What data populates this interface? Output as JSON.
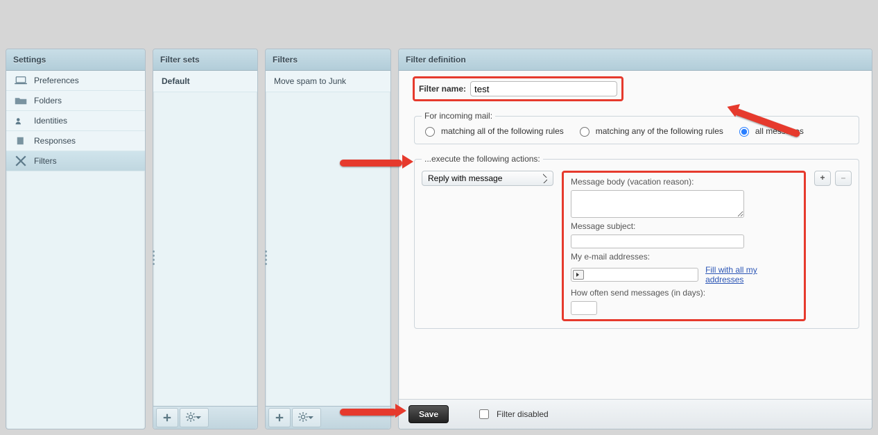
{
  "settings": {
    "title": "Settings",
    "items": [
      {
        "label": "Preferences",
        "icon": "laptop-icon"
      },
      {
        "label": "Folders",
        "icon": "folder-icon"
      },
      {
        "label": "Identities",
        "icon": "person-icon"
      },
      {
        "label": "Responses",
        "icon": "file-icon"
      },
      {
        "label": "Filters",
        "icon": "filter-icon",
        "selected": true
      }
    ]
  },
  "filter_sets": {
    "title": "Filter sets",
    "items": [
      {
        "label": "Default",
        "selected": true,
        "bold": true
      }
    ]
  },
  "filters": {
    "title": "Filters",
    "items": [
      {
        "label": "Move spam to Junk",
        "selected": false
      }
    ]
  },
  "definition": {
    "title": "Filter definition",
    "name_label": "Filter name:",
    "name_value": "test",
    "scope": {
      "legend": "For incoming mail:",
      "opt_all": "matching all of the following rules",
      "opt_any": "matching any of the following rules",
      "opt_every": "all messages",
      "selected": "every"
    },
    "actions": {
      "legend": "...execute the following actions:",
      "select_value": "Reply with message",
      "body_label": "Message body (vacation reason):",
      "body_value": "",
      "subject_label": "Message subject:",
      "subject_value": "",
      "addresses_label": "My e-mail addresses:",
      "fill_link": "Fill with all my addresses",
      "days_label": "How often send messages (in days):",
      "days_value": "",
      "plus": "+",
      "minus": "–"
    },
    "save_label": "Save",
    "disabled_label": "Filter disabled"
  },
  "footer": {
    "add": "+",
    "gear": "⚙"
  }
}
